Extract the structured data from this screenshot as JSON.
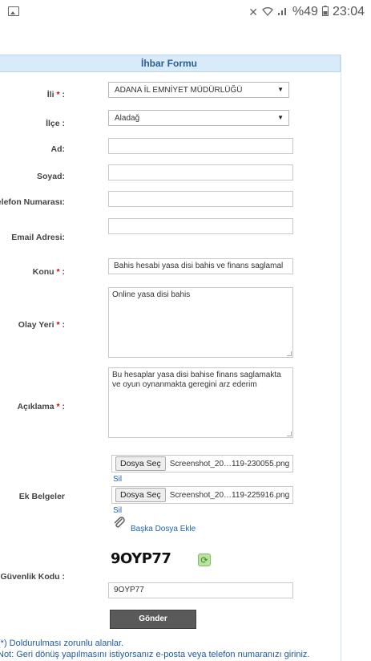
{
  "status_bar": {
    "battery": "%49",
    "time": "23:04",
    "icons": [
      "image-icon",
      "mute-icon",
      "wifi-icon",
      "signal-icon",
      "battery-icon"
    ]
  },
  "form": {
    "title": "İhbar Formu",
    "required_mark": "*",
    "fields": {
      "il": {
        "label": "İli",
        "value": "ADANA İL EMNİYET MÜDÜRLÜĞÜ"
      },
      "ilce": {
        "label": "İlçe :",
        "value": "Aladağ"
      },
      "ad": {
        "label": "Ad:",
        "value": ""
      },
      "soyad": {
        "label": "Soyad:",
        "value": ""
      },
      "telefon": {
        "label": "Telefon Numarası:",
        "value": ""
      },
      "email": {
        "label": "Email Adresi:",
        "value": ""
      },
      "konu": {
        "label": "Konu",
        "value": "Bahis hesabi yasa disi bahis ve finans saglamal"
      },
      "olay_yeri": {
        "label": "Olay Yeri",
        "value": "Online yasa disi bahis"
      },
      "aciklama": {
        "label": "Açıklama",
        "value": "Bu hesaplar yasa disi bahise finans saglamakta ve oyun oynanmakta geregini arz ederim"
      }
    },
    "label_suffix": " :",
    "ek_belgeler": {
      "label": "Ek Belgeler",
      "choose_label": "Dosya Seç",
      "files": [
        "Screenshot_20…119-230055.png",
        "Screenshot_20…119-225916.png"
      ],
      "remove_label": "Sil",
      "add_more_label": "Başka Dosya Ekle"
    },
    "captcha": {
      "label": "Güvenlik Kodu :",
      "code_image_text": "9OYP77",
      "input_value": "9OYP77"
    },
    "submit_label": "Gönder",
    "notes": [
      "(*) Doldurulması zorunlu alanlar.",
      "Not: Geri dönüş yapılmasını istiyorsanız e-posta veya telefon numaranızı giriniz."
    ],
    "colors": {
      "title_bg": "#d9ebf8",
      "title_text": "#2a5f98",
      "required": "#dd0000",
      "link": "#1d63b8",
      "button": "#5a5a5a"
    }
  }
}
